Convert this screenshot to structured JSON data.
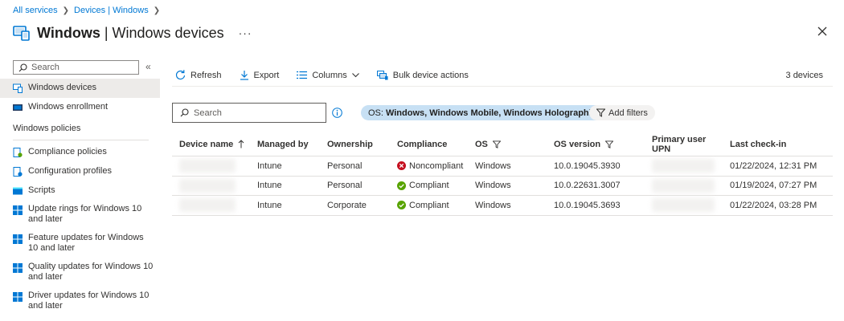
{
  "breadcrumb": {
    "items": [
      "All services",
      "Devices | Windows"
    ]
  },
  "header": {
    "title_bold": "Windows",
    "title_rest": " | Windows devices",
    "more_label": "···"
  },
  "sidebar": {
    "search_placeholder": "Search",
    "collapse_label": "«",
    "items": [
      {
        "label": "Windows devices",
        "icon": "devices-icon",
        "active": true
      },
      {
        "label": "Windows enrollment",
        "icon": "enrollment-icon"
      }
    ],
    "section_title": "Windows policies",
    "policy_items": [
      {
        "label": "Compliance policies",
        "icon": "compliance-policy-icon"
      },
      {
        "label": "Configuration profiles",
        "icon": "configuration-profile-icon"
      },
      {
        "label": "Scripts",
        "icon": "scripts-icon"
      },
      {
        "label": "Update rings for Windows 10 and later",
        "icon": "windows-logo-icon"
      },
      {
        "label": "Feature updates for Windows 10 and later",
        "icon": "windows-logo-icon"
      },
      {
        "label": "Quality updates for Windows 10 and later",
        "icon": "windows-logo-icon"
      },
      {
        "label": "Driver updates for Windows 10 and later",
        "icon": "windows-logo-icon"
      }
    ]
  },
  "toolbar": {
    "refresh_label": "Refresh",
    "export_label": "Export",
    "columns_label": "Columns",
    "bulk_label": "Bulk device actions",
    "device_count": "3 devices"
  },
  "filters": {
    "search_placeholder": "Search",
    "os_filter_key": "OS:",
    "os_filter_value": "Windows, Windows Mobile, Windows Holographic",
    "add_filters_label": "Add filters"
  },
  "table": {
    "columns": [
      "Device name",
      "Managed by",
      "Ownership",
      "Compliance",
      "OS",
      "OS version",
      "Primary user UPN",
      "Last check-in"
    ],
    "rows": [
      {
        "managed_by": "Intune",
        "ownership": "Personal",
        "compliance": "Noncompliant",
        "compliance_status": "error",
        "os": "Windows",
        "os_version": "10.0.19045.3930",
        "last_checkin": "01/22/2024, 12:31 PM"
      },
      {
        "managed_by": "Intune",
        "ownership": "Personal",
        "compliance": "Compliant",
        "compliance_status": "success",
        "os": "Windows",
        "os_version": "10.0.22631.3007",
        "last_checkin": "01/19/2024, 07:27 PM"
      },
      {
        "managed_by": "Intune",
        "ownership": "Corporate",
        "compliance": "Compliant",
        "compliance_status": "success",
        "os": "Windows",
        "os_version": "10.0.19045.3693",
        "last_checkin": "01/22/2024, 03:28 PM"
      }
    ]
  },
  "colors": {
    "accent": "#0078d4",
    "error": "#c50f1f",
    "success": "#57a300",
    "filter_pill": "#c7e0f4"
  }
}
